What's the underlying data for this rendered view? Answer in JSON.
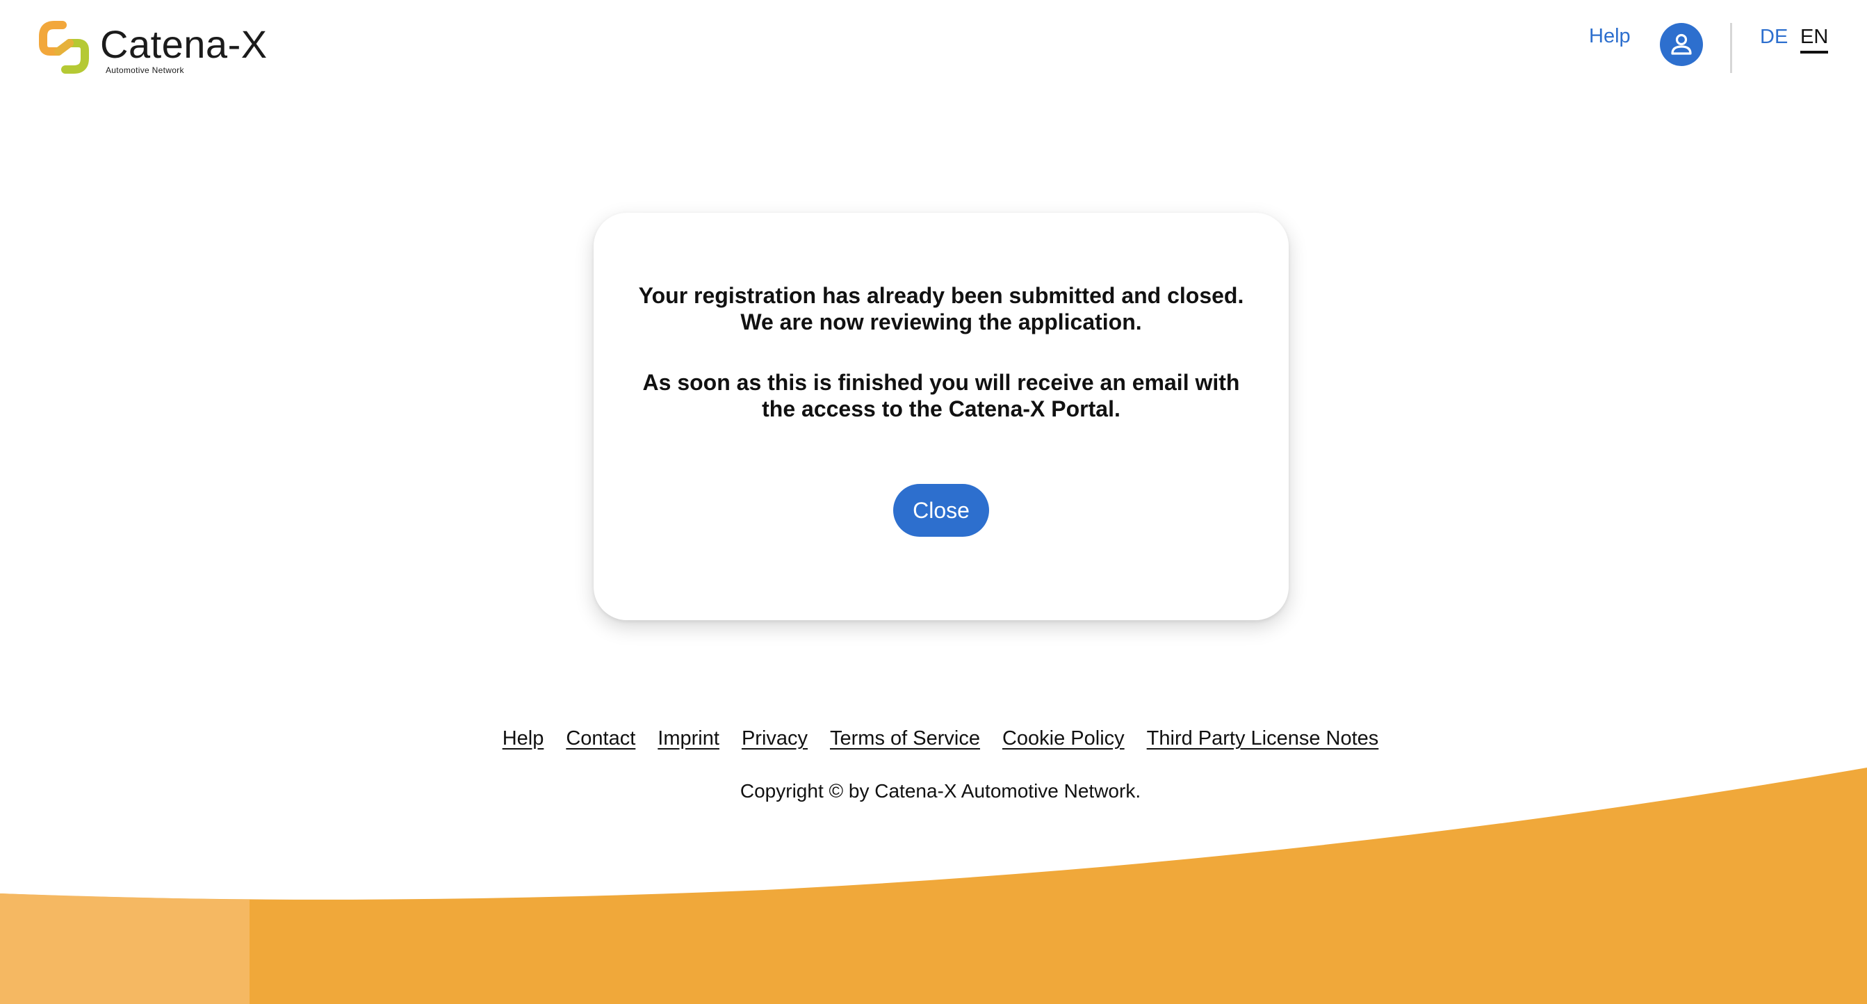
{
  "header": {
    "logo_title": "Catena-X",
    "logo_subtitle": "Automotive Network",
    "help_label": "Help",
    "user_icon": "user-icon",
    "languages": [
      {
        "code": "DE",
        "active": false
      },
      {
        "code": "EN",
        "active": true
      }
    ]
  },
  "dialog": {
    "message_1": "Your registration has already been submitted and closed. We are now reviewing the application.",
    "message_2": "As soon as this is finished you will receive an email with the access to the Catena-X Portal.",
    "close_label": "Close"
  },
  "footer": {
    "links": [
      "Help",
      "Contact",
      "Imprint",
      "Privacy",
      "Terms of Service",
      "Cookie Policy",
      "Third Party License Notes"
    ],
    "copyright": "Copyright © by Catena-X Automotive Network."
  },
  "colors": {
    "accent": "#2d6fce",
    "wave_orange": "#f0a83a",
    "wave_light_orange": "#f5b862",
    "logo_orange": "#f2a73b",
    "logo_green": "#b5c934"
  }
}
